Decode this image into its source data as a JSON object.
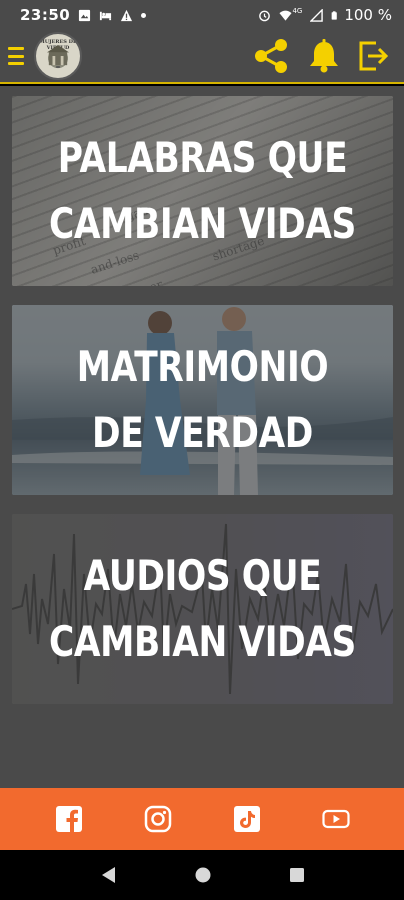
{
  "status_bar": {
    "time": "23:50",
    "battery": "100 %",
    "signal_label": "4G",
    "icons": [
      "image-icon",
      "bed-icon",
      "warning-icon",
      "dot-icon",
      "alarm-icon",
      "wifi-icon",
      "signal-icon",
      "battery-icon"
    ]
  },
  "app_bar": {
    "logo_text": "MUJERES DE VIRTUD",
    "accent_color": "#f4d000",
    "actions": [
      "share-icon",
      "bell-icon",
      "logout-icon"
    ]
  },
  "cards": [
    {
      "title_line1": "PALABRAS QUE",
      "title_line2": "CAMBIAN VIDAS"
    },
    {
      "title_line1": "MATRIMONIO",
      "title_line2": "DE VERDAD"
    },
    {
      "title_line1": "AUDIOS QUE",
      "title_line2": "CAMBIAN VIDAS"
    }
  ],
  "card1_text_snippets": [
    "profit",
    "gain",
    "and-loss",
    "profiteer",
    "shortage"
  ],
  "social_bar": {
    "color": "#f26a2e",
    "icons": [
      "facebook-icon",
      "instagram-icon",
      "tiktok-icon",
      "youtube-icon"
    ]
  },
  "nav_bar": {
    "buttons": [
      "back-icon",
      "home-icon",
      "recents-icon"
    ]
  }
}
